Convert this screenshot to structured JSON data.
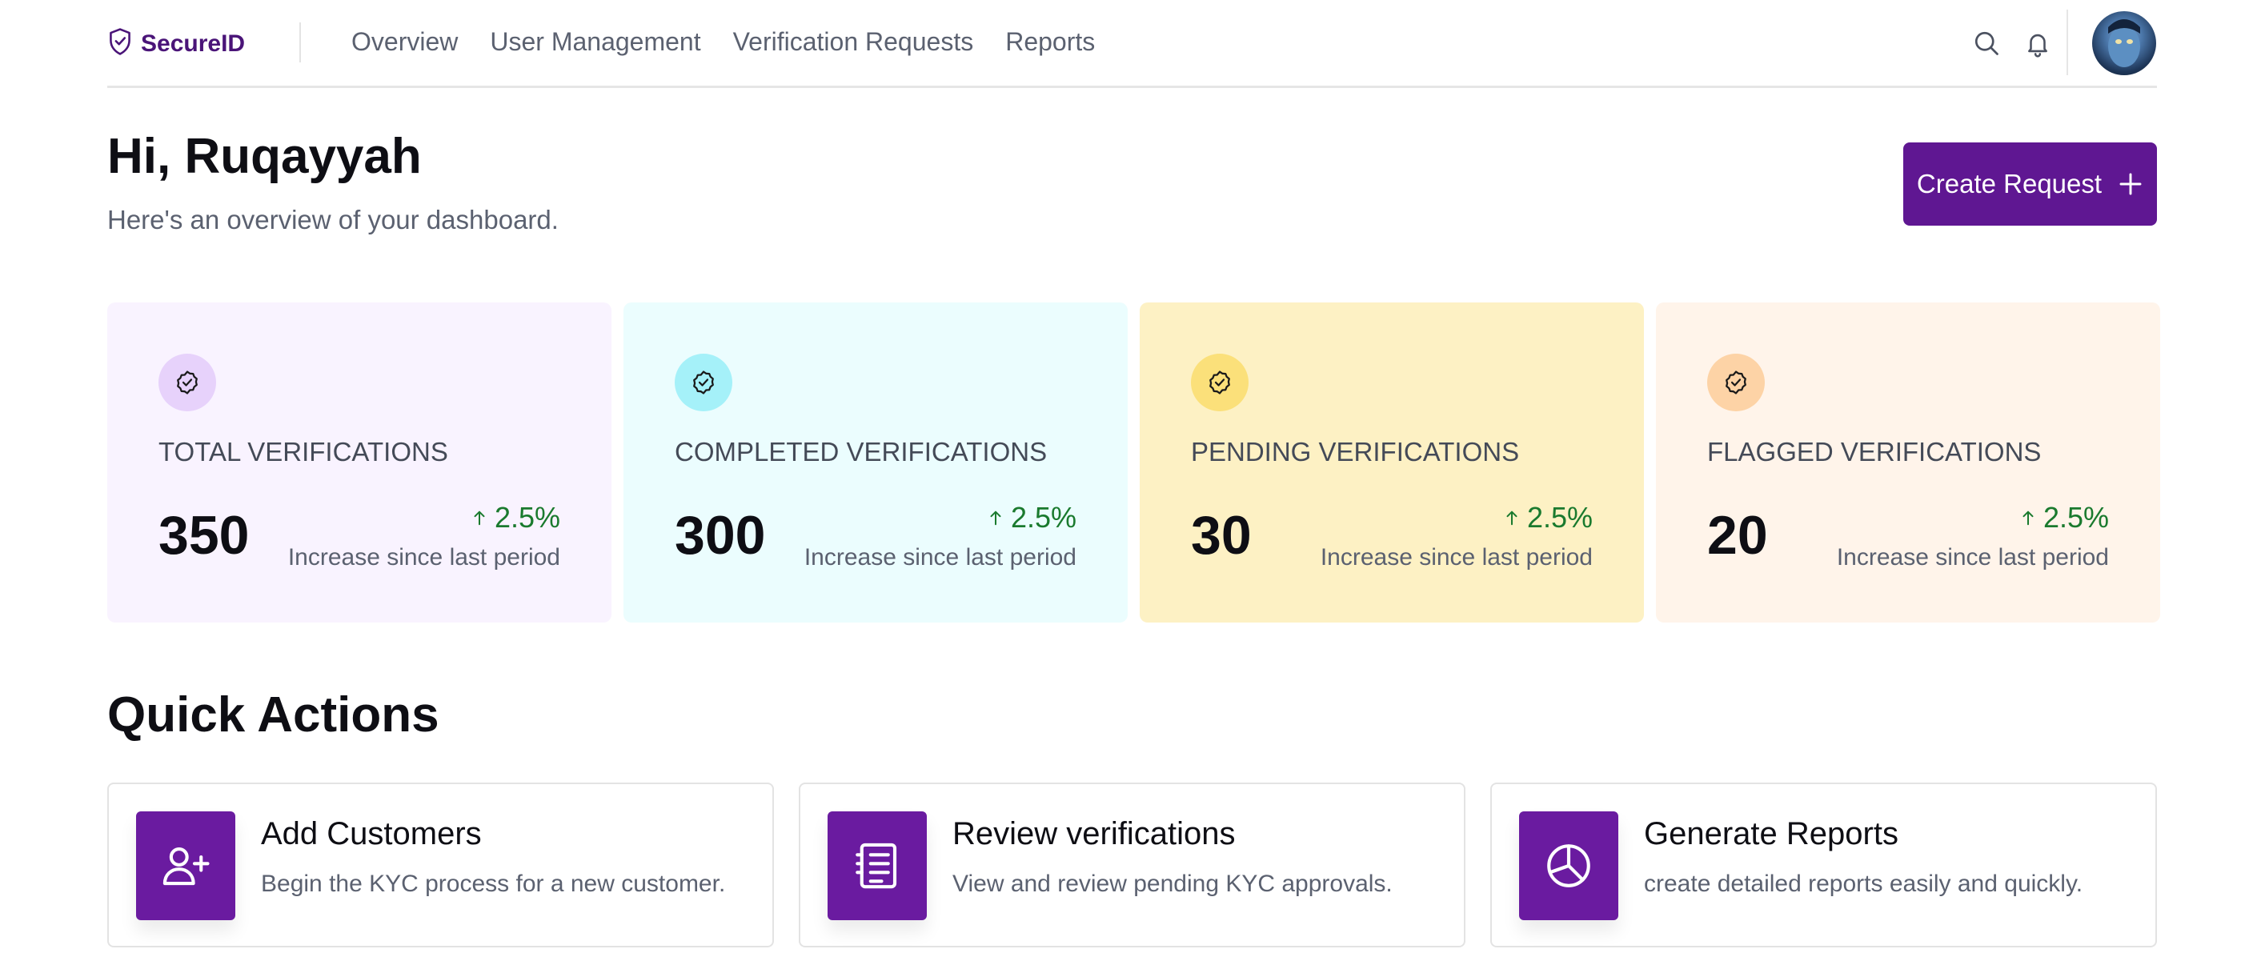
{
  "brand": {
    "name": "SecureID"
  },
  "nav": {
    "items": [
      {
        "label": "Overview"
      },
      {
        "label": "User Management"
      },
      {
        "label": "Verification Requests"
      },
      {
        "label": "Reports"
      }
    ]
  },
  "header": {
    "greeting": "Hi, Ruqayyah",
    "subtitle": "Here's an overview of your dashboard.",
    "create_button": "Create Request"
  },
  "stats": [
    {
      "label": "TOTAL VERIFICATIONS",
      "value": "350",
      "change": "2.5%",
      "note": "Increase since last period",
      "bg": "#f9f3ff",
      "icon_bg": "#e7d2fb"
    },
    {
      "label": "COMPLETED VERIFICATIONS",
      "value": "300",
      "change": "2.5%",
      "note": "Increase since last period",
      "bg": "#ebfdfe",
      "icon_bg": "#a5f1f9"
    },
    {
      "label": "PENDING VERIFICATIONS",
      "value": "30",
      "change": "2.5%",
      "note": "Increase since last period",
      "bg": "#fdf1c4",
      "icon_bg": "#fbe07a"
    },
    {
      "label": "FLAGGED VERIFICATIONS",
      "value": "20",
      "change": "2.5%",
      "note": "Increase since last period",
      "bg": "#fff4ea",
      "icon_bg": "#fdd3a6"
    }
  ],
  "quick_actions": {
    "title": "Quick Actions",
    "items": [
      {
        "name": "Add Customers",
        "desc": "Begin the KYC process for a new customer.",
        "icon": "add-user-icon"
      },
      {
        "name": "Review verifications",
        "desc": "View and review pending KYC approvals.",
        "icon": "checklist-icon"
      },
      {
        "name": "Generate Reports",
        "desc": "create detailed reports easily and quickly.",
        "icon": "pie-chart-icon"
      }
    ]
  },
  "colors": {
    "brand": "#4a1478",
    "accent": "#5f1792",
    "positive": "#1a7a2e"
  }
}
